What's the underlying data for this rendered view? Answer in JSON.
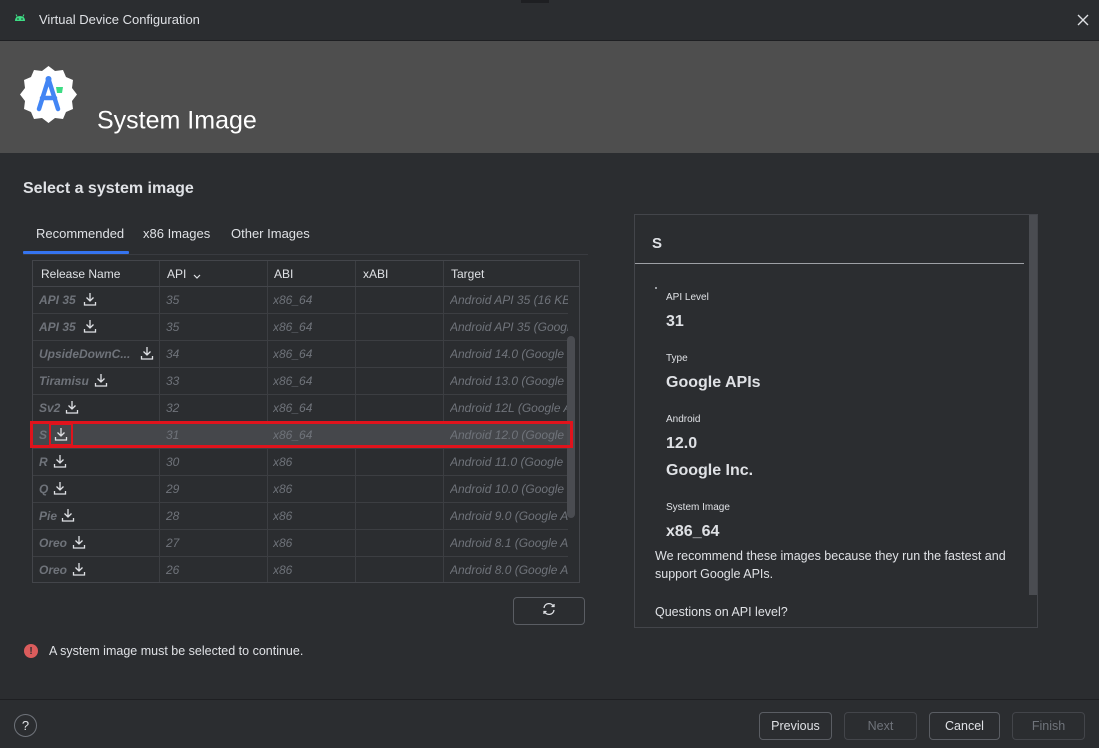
{
  "window": {
    "title": "Virtual Device Configuration",
    "close_icon": "close-icon"
  },
  "banner": {
    "title": "System Image",
    "logo_icon": "android-studio-logo"
  },
  "section_title": "Select a system image",
  "tabs": [
    {
      "label": "Recommended",
      "selected": true
    },
    {
      "label": "x86 Images",
      "selected": false
    },
    {
      "label": "Other Images",
      "selected": false
    }
  ],
  "table": {
    "headers": {
      "release_name": "Release Name",
      "api": "API",
      "abi": "ABI",
      "xabi": "xABI",
      "target": "Target"
    },
    "sort_icon": "chevron-down-icon",
    "rows": [
      {
        "name": "API 35",
        "api": "35",
        "abi": "x86_64",
        "xabi": "",
        "target": "Android API 35 (16 KB"
      },
      {
        "name": "API 35",
        "api": "35",
        "abi": "x86_64",
        "xabi": "",
        "target": "Android API 35 (Google"
      },
      {
        "name": "UpsideDownC...",
        "api": "34",
        "abi": "x86_64",
        "xabi": "",
        "target": "Android 14.0 (Google"
      },
      {
        "name": "Tiramisu",
        "api": "33",
        "abi": "x86_64",
        "xabi": "",
        "target": "Android 13.0 (Google"
      },
      {
        "name": "Sv2",
        "api": "32",
        "abi": "x86_64",
        "xabi": "",
        "target": "Android 12L (Google A"
      },
      {
        "name": "S",
        "api": "31",
        "abi": "x86_64",
        "xabi": "",
        "target": "Android 12.0 (Google",
        "selected": true
      },
      {
        "name": "R",
        "api": "30",
        "abi": "x86",
        "xabi": "",
        "target": "Android 11.0 (Google"
      },
      {
        "name": "Q",
        "api": "29",
        "abi": "x86",
        "xabi": "",
        "target": "Android 10.0 (Google"
      },
      {
        "name": "Pie",
        "api": "28",
        "abi": "x86",
        "xabi": "",
        "target": "Android 9.0 (Google A"
      },
      {
        "name": "Oreo",
        "api": "27",
        "abi": "x86",
        "xabi": "",
        "target": "Android 8.1 (Google A"
      },
      {
        "name": "Oreo",
        "api": "26",
        "abi": "x86",
        "xabi": "",
        "target": "Android 8.0 (Google A"
      }
    ]
  },
  "refresh_icon": "refresh-icon",
  "details": {
    "title": "S",
    "api_level_label": "API Level",
    "api_level_value": "31",
    "type_label": "Type",
    "type_value": "Google APIs",
    "android_label": "Android",
    "android_version": "12.0",
    "vendor": "Google Inc.",
    "system_image_label": "System Image",
    "system_image_value": "x86_64",
    "recommendation_text": "We recommend these images because they run the fastest and support Google APIs.",
    "questions_link": "Questions on API level?"
  },
  "error": {
    "icon": "error-icon",
    "glyph": "!",
    "message": "A system image must be selected to continue."
  },
  "footer": {
    "help_glyph": "?",
    "previous": "Previous",
    "next": "Next",
    "cancel": "Cancel",
    "finish": "Finish"
  },
  "colors": {
    "accent": "#3574f0",
    "highlight": "#e0131c",
    "error": "#db5c5c",
    "banner": "#4e4e4e"
  }
}
